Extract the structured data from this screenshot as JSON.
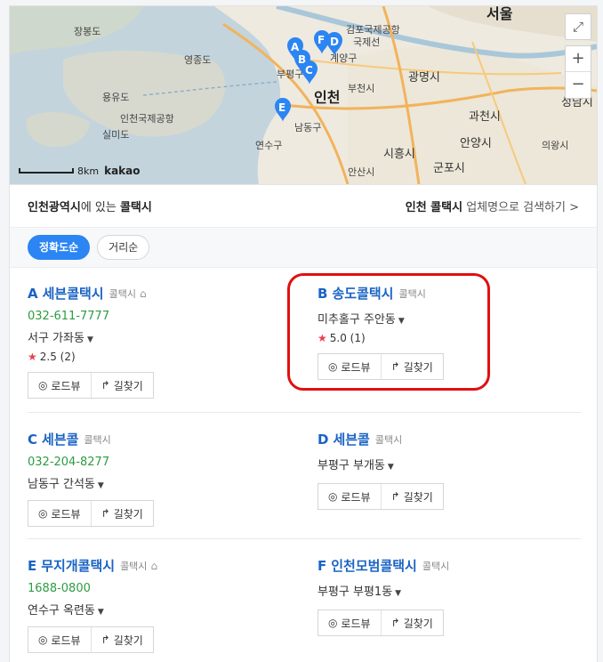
{
  "map": {
    "labels": [
      "장봉도",
      "영종도",
      "용유도",
      "인천국제공항",
      "실미도",
      "김포국제공항",
      "국제선",
      "서울",
      "인천",
      "부평구",
      "계양구",
      "부천시",
      "광명시",
      "시흥시",
      "안양시",
      "과천시",
      "군포시",
      "안산시",
      "의왕시",
      "성남시",
      "연수구",
      "남동구"
    ],
    "markers": [
      "A",
      "B",
      "C",
      "D",
      "E",
      "F"
    ],
    "scale_label": "8km",
    "brand": "kakao",
    "fullscreen_icon": "expand-icon",
    "zoom_in": "+",
    "zoom_out": "−"
  },
  "toolbar": {
    "region": "인천광역시",
    "region_suffix": "에 있는 ",
    "keyword": "콜택시",
    "search_prefix": "인천 콜택시",
    "search_suffix": " 업체명으로 검색하기 >"
  },
  "sort": {
    "accuracy": "정확도순",
    "distance": "거리순"
  },
  "actions": {
    "roadview": "로드뷰",
    "directions": "길찾기"
  },
  "results": [
    {
      "letter": "A",
      "name": "세븐콜택시",
      "category": "콜택시",
      "phone": "032-611-7777",
      "address": "서구 가좌동",
      "rating": "2.5 (2)"
    },
    {
      "letter": "B",
      "name": "송도콜택시",
      "category": "콜택시",
      "phone": "",
      "address": "미추홀구 주안동",
      "rating": "5.0 (1)"
    },
    {
      "letter": "C",
      "name": "세븐콜",
      "category": "콜택시",
      "phone": "032-204-8277",
      "address": "남동구 간석동",
      "rating": ""
    },
    {
      "letter": "D",
      "name": "세븐콜",
      "category": "콜택시",
      "phone": "",
      "address": "부평구 부개동",
      "rating": ""
    },
    {
      "letter": "E",
      "name": "무지개콜택시",
      "category": "콜택시",
      "phone": "1688-0800",
      "address": "연수구 옥련동",
      "rating": ""
    },
    {
      "letter": "F",
      "name": "인천모범콜택시",
      "category": "콜택시",
      "phone": "",
      "address": "부평구 부평1동",
      "rating": ""
    }
  ],
  "colors": {
    "accent": "#2b85f3",
    "link": "#1a63c4",
    "phone": "#2c9c42",
    "star": "#e9414b",
    "highlight": "#e01010"
  }
}
